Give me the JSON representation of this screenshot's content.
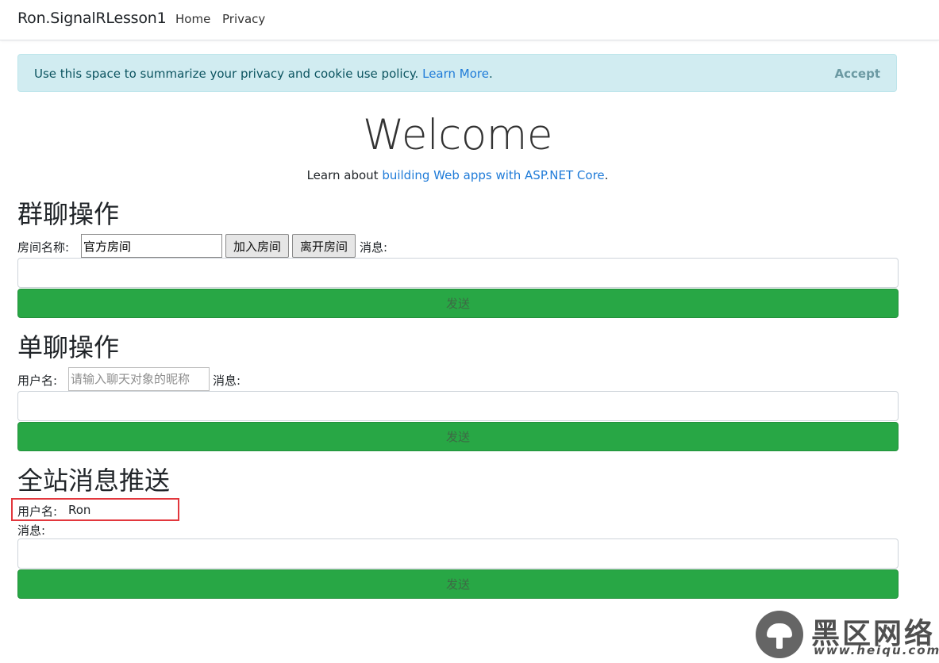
{
  "nav": {
    "brand": "Ron.SignalRLesson1",
    "links": [
      "Home",
      "Privacy"
    ]
  },
  "cookie_alert": {
    "text": "Use this space to summarize your privacy and cookie use policy. ",
    "link": "Learn More",
    "period": ".",
    "accept": "Accept"
  },
  "hero": {
    "title": "Welcome",
    "learn_prefix": "Learn about ",
    "learn_link": "building Web apps with ASP.NET Core",
    "learn_suffix": "."
  },
  "group_chat": {
    "heading": "群聊操作",
    "room_label": "房间名称:",
    "room_value": "官方房间",
    "join_button": "加入房间",
    "leave_button": "离开房间",
    "message_label": "消息:",
    "send_button": "发送"
  },
  "private_chat": {
    "heading": "单聊操作",
    "user_label": "用户名:",
    "user_placeholder": "请输入聊天对象的昵称",
    "message_label": "消息:",
    "send_button": "发送"
  },
  "broadcast": {
    "heading": "全站消息推送",
    "user_label": "用户名:",
    "user_name": "Ron",
    "message_label": "消息:",
    "send_button": "发送"
  },
  "watermark": {
    "text": "黑区网络",
    "url": "www.heiqu.com"
  },
  "colors": {
    "success": "#28a745",
    "alert_bg": "#d1ecf1",
    "link": "#1f7bd8",
    "highlight": "#e2373d"
  }
}
